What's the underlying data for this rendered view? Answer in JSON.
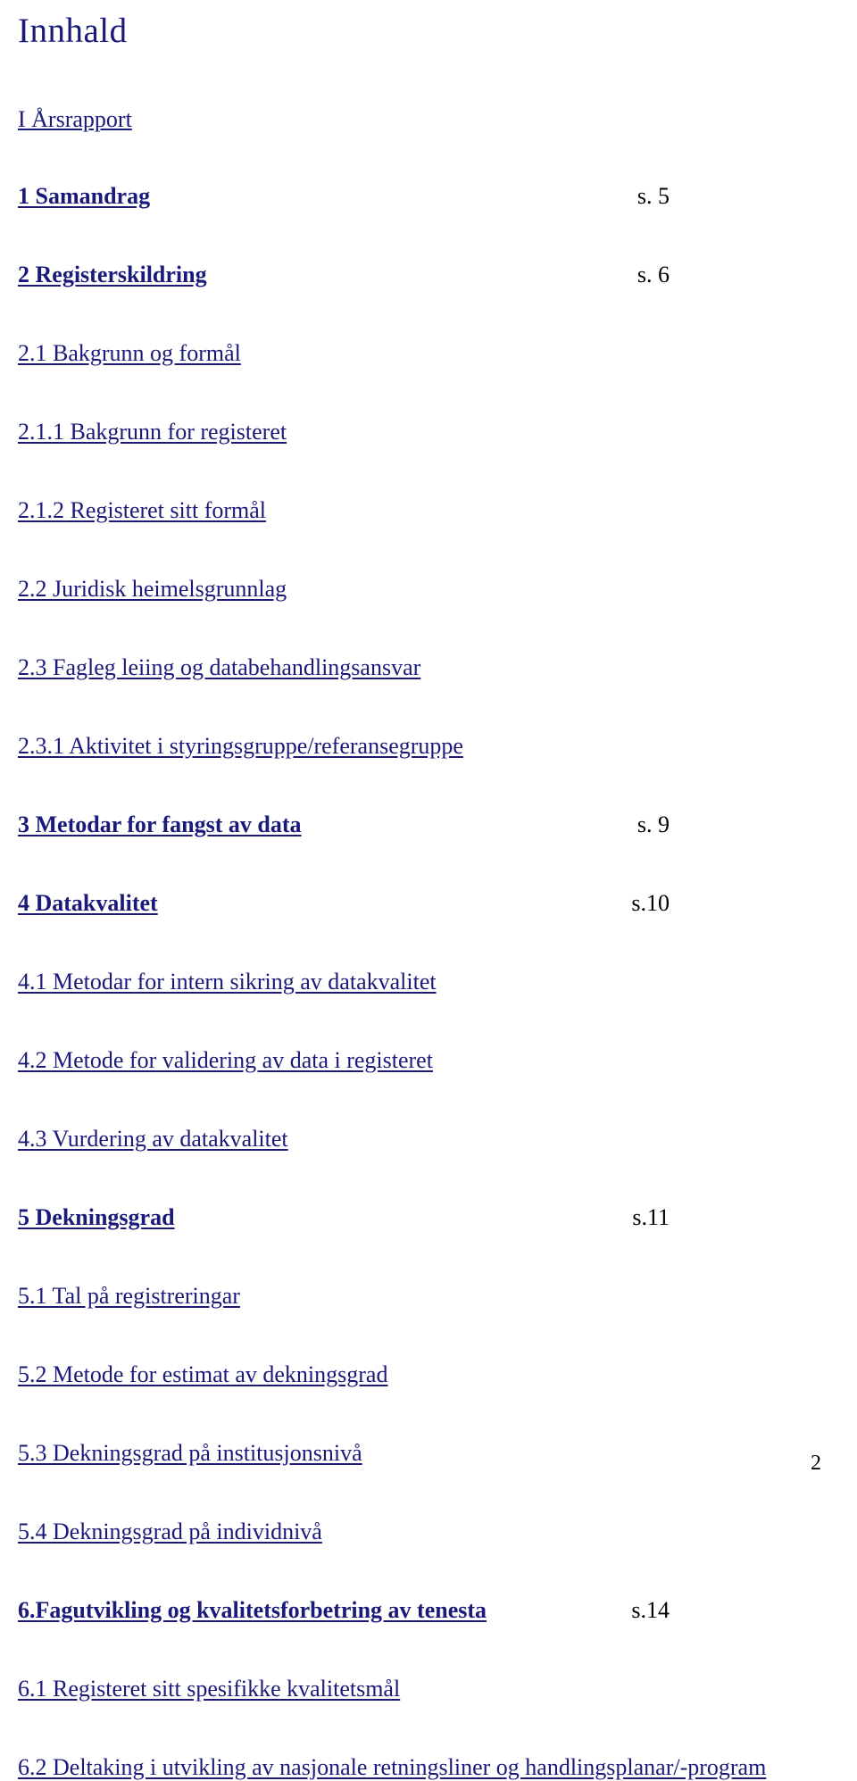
{
  "title": "Innhald",
  "part": "I  Årsrapport",
  "entries": [
    {
      "label": "1 Samandrag",
      "page": "s. 5",
      "bold": true
    },
    {
      "label": "2 Registerskildring",
      "page": "s. 6",
      "bold": true
    },
    {
      "label": "2.1 Bakgrunn og formål",
      "page": "",
      "bold": false
    },
    {
      "label": "2.1.1 Bakgrunn for registeret",
      "page": "",
      "bold": false
    },
    {
      "label": "2.1.2 Registeret sitt formål",
      "page": "",
      "bold": false
    },
    {
      "label": "2.2 Juridisk heimelsgrunnlag",
      "page": "",
      "bold": false
    },
    {
      "label": "2.3 Fagleg leiing og databehandlingsansvar",
      "page": "",
      "bold": false
    },
    {
      "label": "2.3.1 Aktivitet i styringsgruppe/referansegruppe",
      "page": "",
      "bold": false
    },
    {
      "label": "3 Metodar for fangst av data",
      "page": "s. 9",
      "bold": true
    },
    {
      "label": "4 Datakvalitet",
      "page": "s.10",
      "bold": true
    },
    {
      "label": "4.1 Metodar for intern sikring av datakvalitet",
      "page": "",
      "bold": false
    },
    {
      "label": "4.2 Metode for validering av data i registeret",
      "page": "",
      "bold": false
    },
    {
      "label": "4.3 Vurdering av datakvalitet",
      "page": "",
      "bold": false
    },
    {
      "label": "5 Dekningsgrad",
      "page": "s.11",
      "bold": true
    },
    {
      "label": "5.1 Tal på registreringar",
      "page": "",
      "bold": false
    },
    {
      "label": "5.2 Metode for estimat av dekningsgrad",
      "page": "",
      "bold": false
    },
    {
      "label": "5.3 Dekningsgrad på institusjonsnivå",
      "page": "",
      "bold": false
    },
    {
      "label": "5.4 Dekningsgrad på individnivå",
      "page": "",
      "bold": false
    },
    {
      "label": "6.Fagutvikling og kvalitetsforbetring av tenesta",
      "page": "s.14",
      "bold": true
    },
    {
      "label": "6.1 Registeret sitt spesifikke kvalitetsmål",
      "page": "",
      "bold": false
    },
    {
      "label": "6.2 Deltaking i utvikling av nasjonale retningsliner og handlingsplanar/-program",
      "page": "",
      "bold": false
    }
  ],
  "page_number": "2"
}
